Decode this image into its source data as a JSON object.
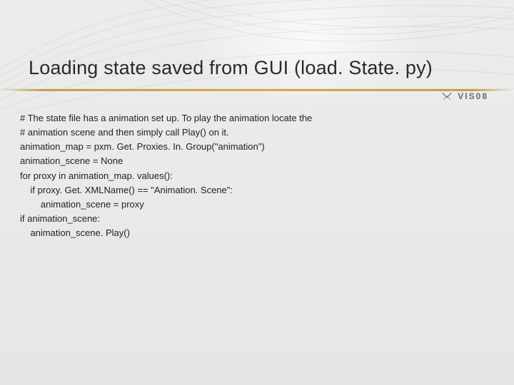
{
  "slide": {
    "title": "Loading state saved from GUI (load. State. py)",
    "logo_text": "VIS08",
    "code_lines": [
      "# The state file has a animation set up. To play the animation locate the",
      "# animation scene and then simply call Play() on it.",
      "animation_map = pxm. Get. Proxies. In. Group(\"animation\")",
      "animation_scene = None",
      "for proxy in animation_map. values():",
      "    if proxy. Get. XMLName() == \"Animation. Scene\":",
      "        animation_scene = proxy",
      "if animation_scene:",
      "    animation_scene. Play()"
    ]
  }
}
